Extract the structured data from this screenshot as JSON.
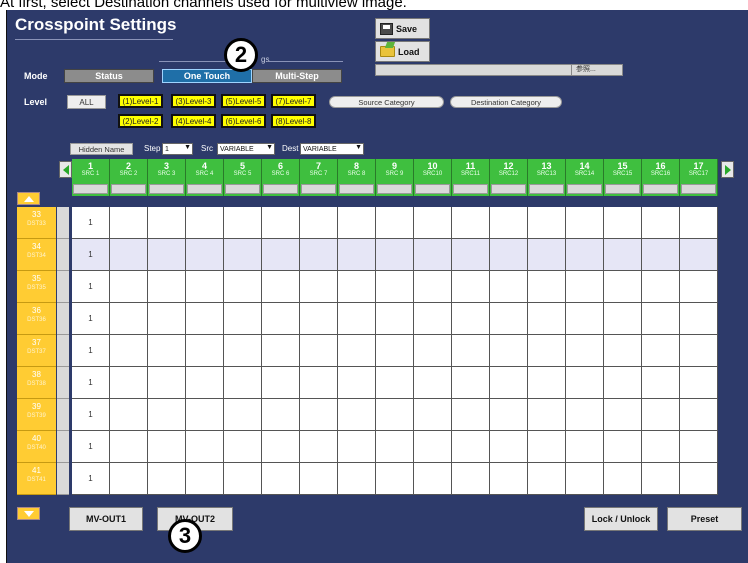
{
  "caption": "At first, select Destination channels used for multiview image.",
  "title": "Crosspoint Settings",
  "toolbar": {
    "save_label": "Save",
    "load_label": "Load",
    "file_field_text": "参照..."
  },
  "mode": {
    "label": "Mode",
    "group_text": "gs",
    "buttons": [
      "Status",
      "One Touch",
      "Multi-Step"
    ],
    "selected": "One Touch"
  },
  "level": {
    "label": "Level",
    "all_label": "ALL",
    "buttons": [
      "(1)Level-1",
      "(3)Level-3",
      "(5)Level-5",
      "(7)Level-7",
      "(2)Level-2",
      "(4)Level-4",
      "(6)Level-6",
      "(8)Level-8"
    ],
    "source_category": "Source Category",
    "destination_category": "Destination Category"
  },
  "options": {
    "hidden_name": "Hidden Name",
    "step_label": "Step",
    "step_value": "1",
    "src_label": "Src",
    "src_value": "VARIABLE",
    "dest_label": "Dest",
    "dest_value": "VARIABLE"
  },
  "sources": [
    {
      "num": "1",
      "name": "SRC 1"
    },
    {
      "num": "2",
      "name": "SRC 2"
    },
    {
      "num": "3",
      "name": "SRC 3"
    },
    {
      "num": "4",
      "name": "SRC 4"
    },
    {
      "num": "5",
      "name": "SRC 5"
    },
    {
      "num": "6",
      "name": "SRC 6"
    },
    {
      "num": "7",
      "name": "SRC 7"
    },
    {
      "num": "8",
      "name": "SRC 8"
    },
    {
      "num": "9",
      "name": "SRC 9"
    },
    {
      "num": "10",
      "name": "SRC10"
    },
    {
      "num": "11",
      "name": "SRC11"
    },
    {
      "num": "12",
      "name": "SRC12"
    },
    {
      "num": "13",
      "name": "SRC13"
    },
    {
      "num": "14",
      "name": "SRC14"
    },
    {
      "num": "15",
      "name": "SRC15"
    },
    {
      "num": "16",
      "name": "SRC16"
    },
    {
      "num": "17",
      "name": "SRC17"
    }
  ],
  "destinations": [
    {
      "num": "33",
      "name": "DST33",
      "value": "1"
    },
    {
      "num": "34",
      "name": "DST34",
      "value": "1"
    },
    {
      "num": "35",
      "name": "DST35",
      "value": "1"
    },
    {
      "num": "36",
      "name": "DST36",
      "value": "1"
    },
    {
      "num": "37",
      "name": "DST37",
      "value": "1"
    },
    {
      "num": "38",
      "name": "DST38",
      "value": "1"
    },
    {
      "num": "39",
      "name": "DST39",
      "value": "1"
    },
    {
      "num": "40",
      "name": "DST40",
      "value": "1"
    },
    {
      "num": "41",
      "name": "DST41",
      "value": "1"
    }
  ],
  "highlight_row": 1,
  "bottom": {
    "mv_out1": "MV-OUT1",
    "mv_out2": "MV-OUT2",
    "lock_unlock": "Lock / Unlock",
    "preset": "Preset"
  },
  "badges": [
    "2",
    "3"
  ]
}
